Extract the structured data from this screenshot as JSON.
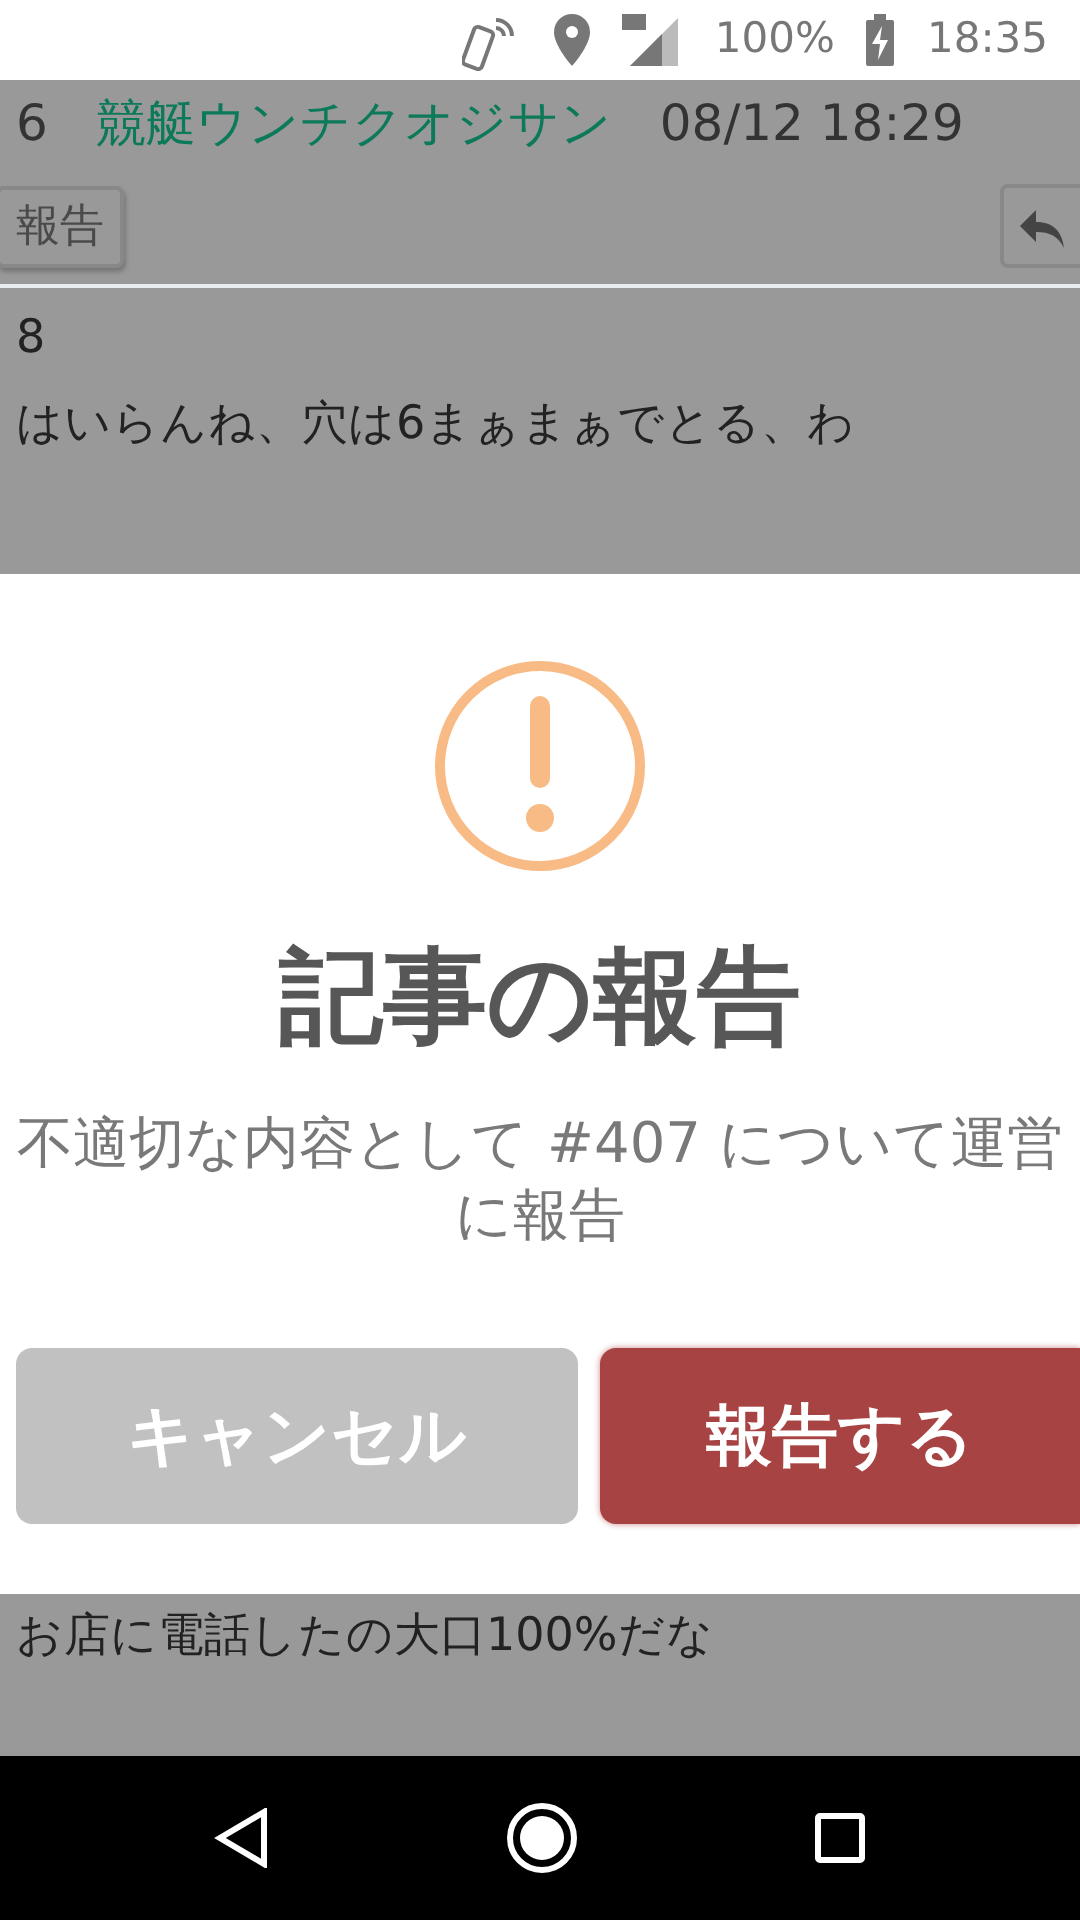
{
  "status_bar": {
    "battery": "100%",
    "time": "18:35"
  },
  "background_post": {
    "number": "6",
    "author": "競艇ウンチクオジサン",
    "date": "08/12 18:29",
    "report_button": "報告",
    "lines": [
      "8",
      "はいらんね、穴は6まぁまぁでとる、わ"
    ]
  },
  "dialog": {
    "title": "記事の報告",
    "message": "不適切な内容として #407 について運営に報告",
    "buttons": [
      {
        "label": "キャンセル",
        "kind": "cancel"
      },
      {
        "label": "報告する",
        "kind": "confirm"
      }
    ]
  },
  "next_post": {
    "text": "お店に電話したの大口100%だな"
  }
}
